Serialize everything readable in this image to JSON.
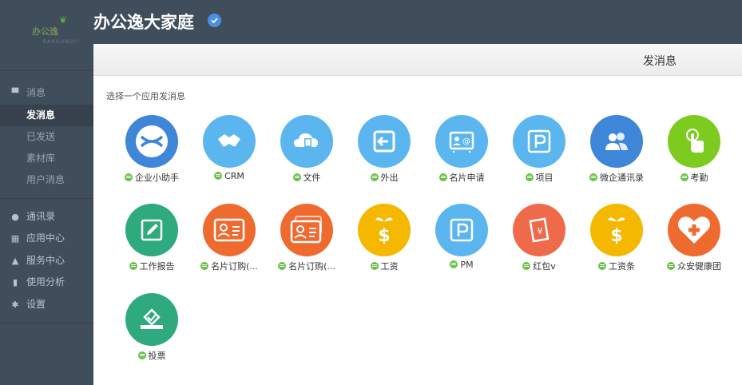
{
  "app": {
    "title": "办公逸大家庭",
    "logo_text": "办公逸",
    "logo_sub": "BANGONGYI"
  },
  "sidebar": {
    "groups": [
      {
        "label": "消息",
        "icon": "chat-icon"
      },
      {
        "label": "通讯录",
        "icon": "contacts-icon"
      },
      {
        "label": "应用中心",
        "icon": "apps-icon"
      },
      {
        "label": "服务中心",
        "icon": "service-icon"
      },
      {
        "label": "使用分析",
        "icon": "chart-icon"
      },
      {
        "label": "设置",
        "icon": "gear-icon"
      }
    ],
    "message_sub": [
      "发消息",
      "已发送",
      "素材库",
      "用户消息"
    ],
    "active": "发消息"
  },
  "panel": {
    "title": "发消息",
    "hint": "选择一个应用发消息"
  },
  "apps": [
    {
      "label": "企业小助手",
      "color": "#3d86d8",
      "icon": "assistant-icon"
    },
    {
      "label": "CRM",
      "color": "#5bb6f0",
      "icon": "handshake-icon"
    },
    {
      "label": "文件",
      "color": "#5bb6f0",
      "icon": "cloud-file-icon"
    },
    {
      "label": "外出",
      "color": "#5bb6f0",
      "icon": "exit-icon"
    },
    {
      "label": "名片申请",
      "color": "#5bb6f0",
      "icon": "business-card-icon"
    },
    {
      "label": "项目",
      "color": "#5bb6f0",
      "icon": "project-p-icon"
    },
    {
      "label": "微企通讯录",
      "color": "#3d86d8",
      "icon": "people-icon"
    },
    {
      "label": "考勤",
      "color": "#7ecb20",
      "icon": "touch-icon"
    },
    {
      "label": "工作报告",
      "color": "#2eaa7e",
      "icon": "edit-report-icon"
    },
    {
      "label": "名片订购(...",
      "color": "#ee6a2f",
      "icon": "id-card-icon"
    },
    {
      "label": "名片订购(...",
      "color": "#ee6a2f",
      "icon": "id-cards-stack-icon"
    },
    {
      "label": "工资",
      "color": "#f5b800",
      "icon": "salary-icon"
    },
    {
      "label": "PM",
      "color": "#5bb6f0",
      "icon": "pm-p-icon"
    },
    {
      "label": "红包v",
      "color": "#ee6a4a",
      "icon": "red-packet-icon"
    },
    {
      "label": "工资条",
      "color": "#f5b800",
      "icon": "payslip-icon"
    },
    {
      "label": "众安健康团",
      "color": "#ee6a2f",
      "icon": "health-heart-icon"
    },
    {
      "label": "投票",
      "color": "#2eaa7e",
      "icon": "vote-icon"
    }
  ]
}
